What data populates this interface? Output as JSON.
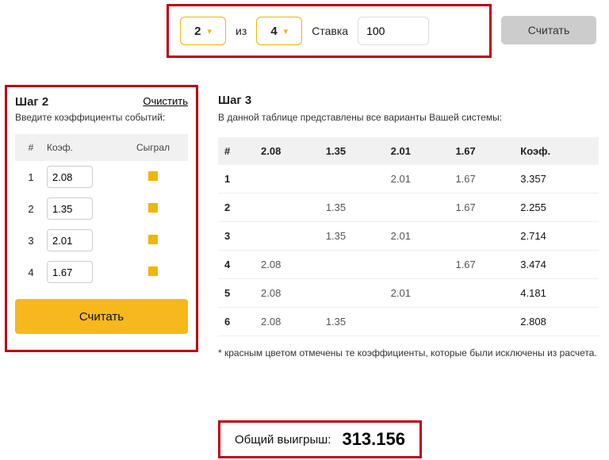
{
  "top": {
    "pick": "2",
    "of_label": "из",
    "total": "4",
    "stake_label": "Ставка",
    "stake_value": "100",
    "calc_label": "Считать"
  },
  "step2": {
    "title": "Шаг 2",
    "clear": "Очистить",
    "subtitle": "Введите коэффициенты событий:",
    "head_num": "#",
    "head_coef": "Коэф.",
    "head_played": "Сыграл",
    "rows": [
      {
        "n": "1",
        "coef": "2.08"
      },
      {
        "n": "2",
        "coef": "1.35"
      },
      {
        "n": "3",
        "coef": "2.01"
      },
      {
        "n": "4",
        "coef": "1.67"
      }
    ],
    "calc_label": "Считать"
  },
  "step3": {
    "title": "Шаг 3",
    "subtitle": "В данной таблице представлены все варианты Вашей системы:",
    "head": [
      "#",
      "2.08",
      "1.35",
      "2.01",
      "1.67",
      "Коэф."
    ],
    "rows": [
      {
        "n": "1",
        "c": [
          "",
          "",
          "2.01",
          "1.67"
        ],
        "k": "3.357"
      },
      {
        "n": "2",
        "c": [
          "",
          "1.35",
          "",
          "1.67"
        ],
        "k": "2.255"
      },
      {
        "n": "3",
        "c": [
          "",
          "1.35",
          "2.01",
          ""
        ],
        "k": "2.714"
      },
      {
        "n": "4",
        "c": [
          "2.08",
          "",
          "",
          "1.67"
        ],
        "k": "3.474"
      },
      {
        "n": "5",
        "c": [
          "2.08",
          "",
          "2.01",
          ""
        ],
        "k": "4.181"
      },
      {
        "n": "6",
        "c": [
          "2.08",
          "1.35",
          "",
          ""
        ],
        "k": "2.808"
      }
    ],
    "footnote": "* красным цветом отмечены те коэффициенты, которые были исключены из расчета."
  },
  "total": {
    "label": "Общий выигрыш:",
    "value": "313.156"
  }
}
